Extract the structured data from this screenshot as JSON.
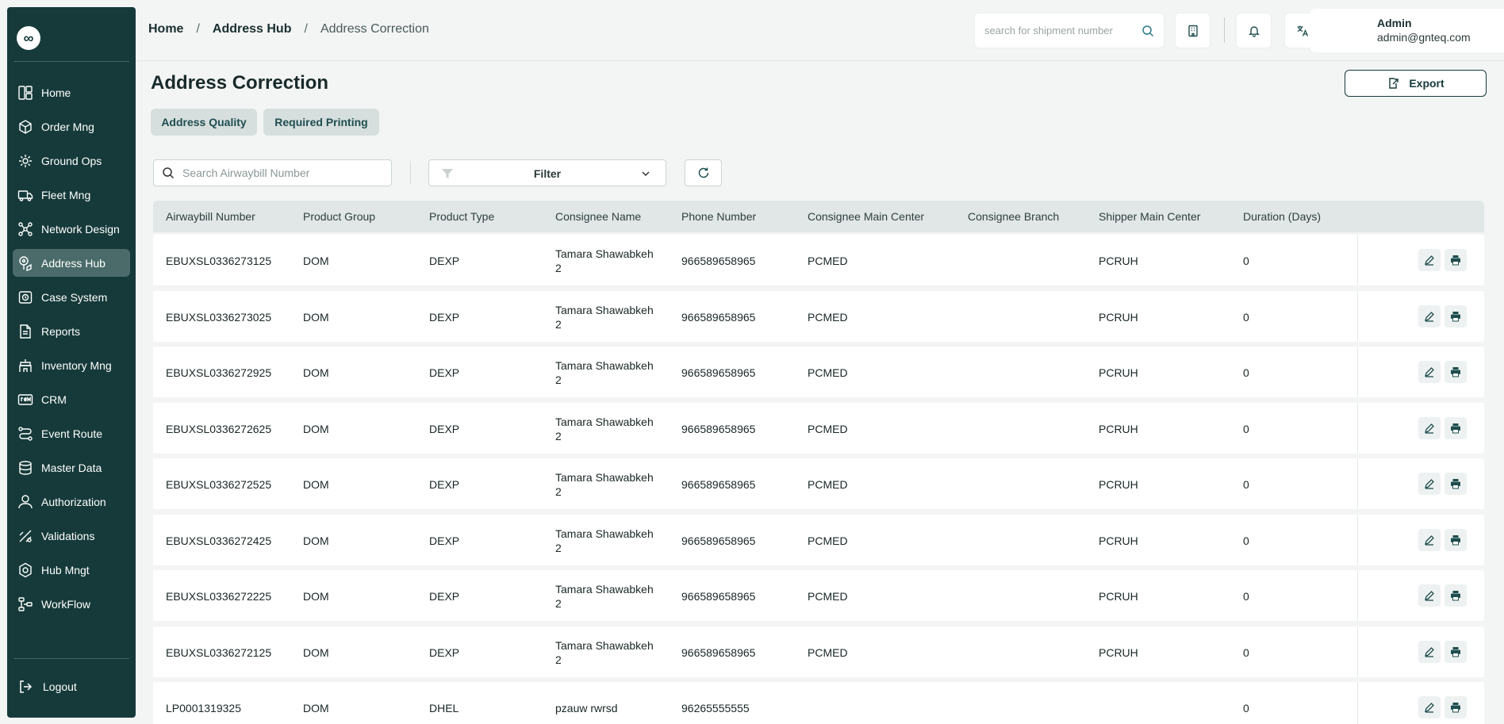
{
  "sidebar": {
    "logo_glyph": "∞",
    "items": [
      {
        "label": "Home",
        "icon": "dashboard-icon"
      },
      {
        "label": "Order Mng",
        "icon": "package-icon"
      },
      {
        "label": "Ground Ops",
        "icon": "gear-network-icon"
      },
      {
        "label": "Fleet Mng",
        "icon": "truck-icon"
      },
      {
        "label": "Network Design",
        "icon": "network-icon"
      },
      {
        "label": "Address Hub",
        "icon": "map-pin-icon",
        "active": true
      },
      {
        "label": "Case System",
        "icon": "case-icon"
      },
      {
        "label": "Reports",
        "icon": "document-icon"
      },
      {
        "label": "Inventory Mng",
        "icon": "inventory-icon"
      },
      {
        "label": "CRM",
        "icon": "crm-icon"
      },
      {
        "label": "Event Route",
        "icon": "route-icon"
      },
      {
        "label": "Master Data",
        "icon": "database-icon"
      },
      {
        "label": "Authorization",
        "icon": "user-icon"
      },
      {
        "label": "Validations",
        "icon": "validation-icon"
      },
      {
        "label": "Hub Mngt",
        "icon": "hub-gear-icon"
      },
      {
        "label": "WorkFlow",
        "icon": "workflow-icon"
      }
    ],
    "logout_label": "Logout"
  },
  "header": {
    "breadcrumb": [
      "Home",
      "Address Hub",
      "Address Correction"
    ],
    "search_placeholder": "search for shipment number",
    "user_name": "Admin",
    "user_email": "admin@gnteq.com"
  },
  "page": {
    "title": "Address Correction",
    "export_label": "Export",
    "tabs": [
      "Address Quality",
      "Required Printing"
    ]
  },
  "toolbar": {
    "search_placeholder": "Search Airwaybill Number",
    "filter_label": "Filter"
  },
  "table": {
    "columns": [
      "Airwaybill Number",
      "Product Group",
      "Product Type",
      "Consignee Name",
      "Phone Number",
      "Consignee Main Center",
      "Consignee Branch",
      "Shipper Main Center",
      "Duration (Days)"
    ],
    "rows": [
      {
        "awb": "EBUXSL0336273125",
        "group": "DOM",
        "type": "DEXP",
        "consignee": "Tamara Shawabkeh 2",
        "phone": "966589658965",
        "main_center": "PCMED",
        "branch": "",
        "shipper_center": "PCRUH",
        "duration": "0"
      },
      {
        "awb": "EBUXSL0336273025",
        "group": "DOM",
        "type": "DEXP",
        "consignee": "Tamara Shawabkeh 2",
        "phone": "966589658965",
        "main_center": "PCMED",
        "branch": "",
        "shipper_center": "PCRUH",
        "duration": "0"
      },
      {
        "awb": "EBUXSL0336272925",
        "group": "DOM",
        "type": "DEXP",
        "consignee": "Tamara Shawabkeh 2",
        "phone": "966589658965",
        "main_center": "PCMED",
        "branch": "",
        "shipper_center": "PCRUH",
        "duration": "0"
      },
      {
        "awb": "EBUXSL0336272625",
        "group": "DOM",
        "type": "DEXP",
        "consignee": "Tamara Shawabkeh 2",
        "phone": "966589658965",
        "main_center": "PCMED",
        "branch": "",
        "shipper_center": "PCRUH",
        "duration": "0"
      },
      {
        "awb": "EBUXSL0336272525",
        "group": "DOM",
        "type": "DEXP",
        "consignee": "Tamara Shawabkeh 2",
        "phone": "966589658965",
        "main_center": "PCMED",
        "branch": "",
        "shipper_center": "PCRUH",
        "duration": "0"
      },
      {
        "awb": "EBUXSL0336272425",
        "group": "DOM",
        "type": "DEXP",
        "consignee": "Tamara Shawabkeh 2",
        "phone": "966589658965",
        "main_center": "PCMED",
        "branch": "",
        "shipper_center": "PCRUH",
        "duration": "0"
      },
      {
        "awb": "EBUXSL0336272225",
        "group": "DOM",
        "type": "DEXP",
        "consignee": "Tamara Shawabkeh 2",
        "phone": "966589658965",
        "main_center": "PCMED",
        "branch": "",
        "shipper_center": "PCRUH",
        "duration": "0"
      },
      {
        "awb": "EBUXSL0336272125",
        "group": "DOM",
        "type": "DEXP",
        "consignee": "Tamara Shawabkeh 2",
        "phone": "966589658965",
        "main_center": "PCMED",
        "branch": "",
        "shipper_center": "PCRUH",
        "duration": "0"
      },
      {
        "awb": "LP0001319325",
        "group": "DOM",
        "type": "DHEL",
        "consignee": "pzauw rwrsd",
        "phone": "96265555555",
        "main_center": "",
        "branch": "",
        "shipper_center": "",
        "duration": "0"
      }
    ]
  },
  "colors": {
    "sidebar_bg": "#163a3a",
    "sidebar_active": "#4b6b6b",
    "accent": "#1f4e4e",
    "page_bg": "#f3f4f4"
  }
}
